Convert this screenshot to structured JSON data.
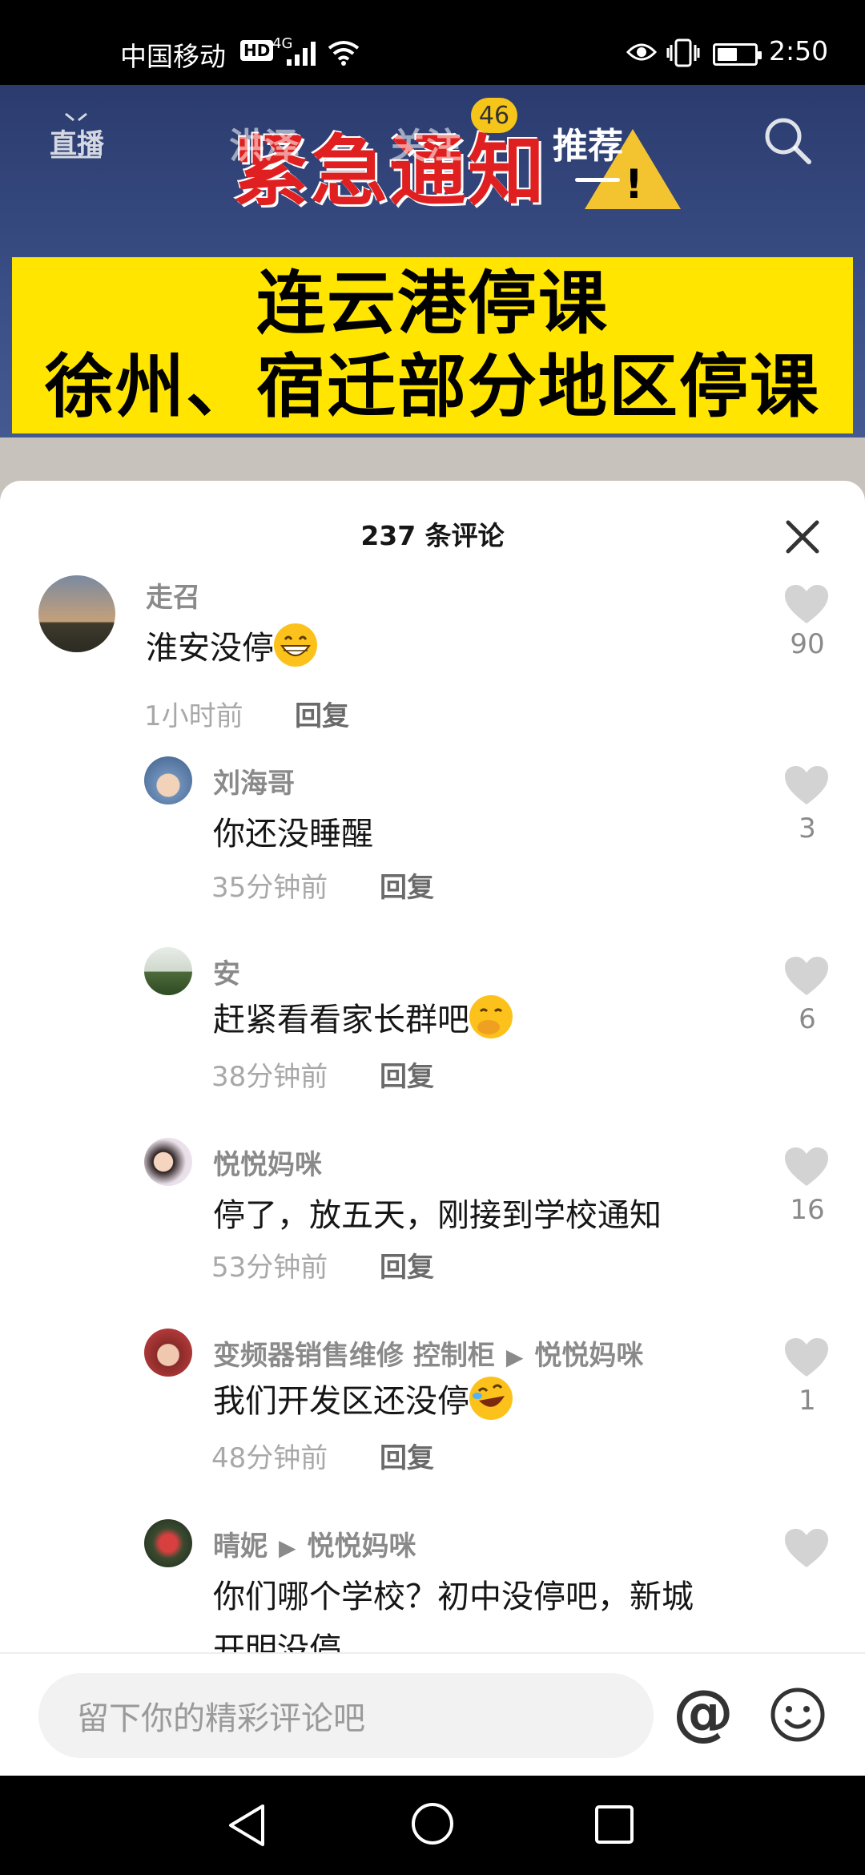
{
  "status_bar": {
    "carrier": "中国移动",
    "hd": "HD",
    "network": "4G",
    "time": "2:50",
    "battery_level": 0.55
  },
  "video": {
    "warning_text": "紧急通知",
    "banner_line1": "连云港停课",
    "banner_line2": "徐州、宿迁部分地区停课"
  },
  "top_nav": {
    "live_label": "直播",
    "tabs": [
      "洪泽",
      "关注",
      "推荐"
    ],
    "active_tab": 2,
    "follow_badge": "46"
  },
  "comments_sheet": {
    "title": "237 条评论",
    "reply_label": "回复",
    "comments": [
      {
        "name": "走召",
        "text": "淮安没停",
        "time": "1小时前",
        "likes": "90",
        "emoji": "grin-emoji"
      },
      {
        "name": "刘海哥",
        "text": "你还没睡醒",
        "time": "35分钟前",
        "likes": "3"
      },
      {
        "name": "安",
        "text": "赶紧看看家长群吧",
        "time": "38分钟前",
        "likes": "6",
        "emoji": "hand-over-mouth-emoji"
      },
      {
        "name": "悦悦妈咪",
        "text": "停了，放五天，刚接到学校通知",
        "time": "53分钟前",
        "likes": "16"
      },
      {
        "name": "变频器销售维修  控制柜",
        "reply_to": "悦悦妈咪",
        "text": "我们开发区还没停",
        "time": "48分钟前",
        "likes": "1",
        "emoji": "rofl-emoji"
      },
      {
        "name": "晴妮",
        "reply_to": "悦悦妈咪",
        "text": "你们哪个学校？初中没停吧，新城",
        "text2": "开明没停",
        "likes": ""
      }
    ]
  },
  "input": {
    "placeholder": "留下你的精彩评论吧",
    "at_symbol": "@"
  }
}
